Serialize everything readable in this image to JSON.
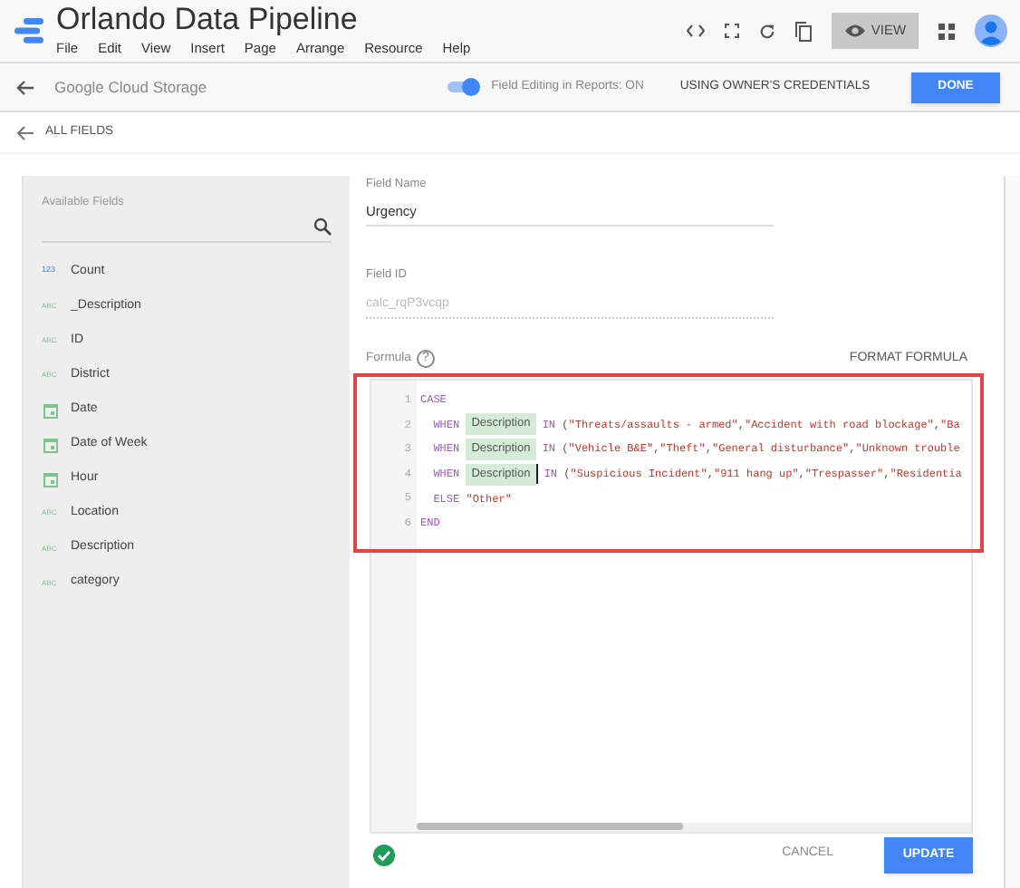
{
  "app": {
    "title": "Orlando Data Pipeline",
    "menu": [
      "File",
      "Edit",
      "View",
      "Insert",
      "Page",
      "Arrange",
      "Resource",
      "Help"
    ],
    "view_button": "VIEW"
  },
  "data_source_bar": {
    "name": "Google Cloud Storage",
    "toggle": {
      "label": "Field Editing in Reports: ON",
      "on": true
    },
    "credentials": "USING OWNER'S CREDENTIALS",
    "done": "DONE"
  },
  "back_link": "ALL FIELDS",
  "available_fields": {
    "title": "Available Fields",
    "fields": [
      {
        "kind": "number",
        "badge": "123",
        "name": "Count"
      },
      {
        "kind": "text",
        "badge": "ABC",
        "name": "_Description"
      },
      {
        "kind": "text",
        "badge": "ABC",
        "name": "ID"
      },
      {
        "kind": "text",
        "badge": "ABC",
        "name": "District"
      },
      {
        "kind": "date",
        "name": "Date"
      },
      {
        "kind": "date",
        "name": "Date of Week"
      },
      {
        "kind": "date",
        "name": "Hour"
      },
      {
        "kind": "text",
        "badge": "ABC",
        "name": "Location"
      },
      {
        "kind": "text",
        "badge": "ABC",
        "name": "Description"
      },
      {
        "kind": "text",
        "badge": "ABC",
        "name": "category"
      }
    ]
  },
  "field_name": {
    "label": "Field Name",
    "value": "Urgency"
  },
  "field_id": {
    "label": "Field ID",
    "value": "calc_rqP3vcqp"
  },
  "formula": {
    "label": "Formula",
    "help": "?",
    "format": "FORMAT FORMULA",
    "valid": true,
    "lines": [
      {
        "number": "1",
        "cursor": false,
        "tokens": [
          {
            "kind": "keyword",
            "text": "CASE"
          }
        ]
      },
      {
        "number": "2",
        "cursor": false,
        "tokens": [
          {
            "kind": "keyword",
            "text": "  WHEN "
          },
          {
            "kind": "field",
            "text": "Description"
          },
          {
            "kind": "keyword",
            "text": " IN "
          },
          {
            "kind": "plain",
            "text": "("
          },
          {
            "kind": "string",
            "text": "\"Threats/assaults - armed\""
          },
          {
            "kind": "plain",
            "text": ","
          },
          {
            "kind": "string",
            "text": "\"Accident with road blockage\""
          },
          {
            "kind": "plain",
            "text": ","
          },
          {
            "kind": "string",
            "text": "\"Ba"
          }
        ]
      },
      {
        "number": "3",
        "cursor": false,
        "tokens": [
          {
            "kind": "keyword",
            "text": "  WHEN "
          },
          {
            "kind": "field",
            "text": "Description"
          },
          {
            "kind": "keyword",
            "text": " IN "
          },
          {
            "kind": "plain",
            "text": "("
          },
          {
            "kind": "string",
            "text": "\"Vehicle B&E\""
          },
          {
            "kind": "plain",
            "text": ","
          },
          {
            "kind": "string",
            "text": "\"Theft\""
          },
          {
            "kind": "plain",
            "text": ","
          },
          {
            "kind": "string",
            "text": "\"General disturbance\""
          },
          {
            "kind": "plain",
            "text": ","
          },
          {
            "kind": "string",
            "text": "\"Unknown trouble"
          }
        ]
      },
      {
        "number": "4",
        "cursor": true,
        "tokens": [
          {
            "kind": "keyword",
            "text": "  WHEN "
          },
          {
            "kind": "field",
            "text": "Description"
          },
          {
            "kind": "keyword",
            "text": " IN "
          },
          {
            "kind": "plain",
            "text": "("
          },
          {
            "kind": "string",
            "text": "\"Suspicious Incident\""
          },
          {
            "kind": "plain",
            "text": ","
          },
          {
            "kind": "string",
            "text": "\"911 hang up\""
          },
          {
            "kind": "plain",
            "text": ","
          },
          {
            "kind": "string",
            "text": "\"Trespasser\""
          },
          {
            "kind": "plain",
            "text": ","
          },
          {
            "kind": "string",
            "text": "\"Residentia"
          }
        ]
      },
      {
        "number": "5",
        "cursor": false,
        "tokens": [
          {
            "kind": "keyword",
            "text": "  ELSE "
          },
          {
            "kind": "string",
            "text": "\"Other\""
          }
        ]
      },
      {
        "number": "6",
        "cursor": false,
        "tokens": [
          {
            "kind": "keyword",
            "text": "END"
          }
        ]
      }
    ]
  },
  "actions": {
    "cancel": "CANCEL",
    "update": "UPDATE"
  }
}
